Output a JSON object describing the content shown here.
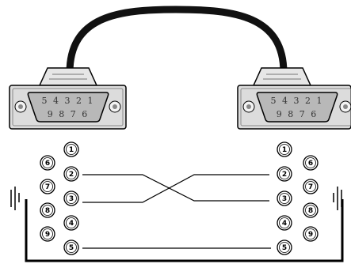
{
  "connectors": [
    {
      "side": "left",
      "face_rows": [
        [
          "5",
          "4",
          "3",
          "2",
          "1"
        ],
        [
          "9",
          "8",
          "7",
          "6"
        ]
      ]
    },
    {
      "side": "right",
      "face_rows": [
        [
          "5",
          "4",
          "3",
          "2",
          "1"
        ],
        [
          "9",
          "8",
          "7",
          "6"
        ]
      ]
    }
  ],
  "pins_left": {
    "column_a": [
      "1",
      "2",
      "3",
      "4",
      "5"
    ],
    "column_b": [
      "6",
      "7",
      "8",
      "9"
    ]
  },
  "pins_right": {
    "column_a": [
      "1",
      "2",
      "3",
      "4",
      "5"
    ],
    "column_b": [
      "6",
      "7",
      "8",
      "9"
    ]
  },
  "wiring": [
    {
      "from": "2",
      "to": "3"
    },
    {
      "from": "3",
      "to": "2"
    },
    {
      "from": "5",
      "to": "5"
    }
  ],
  "colors": {
    "cable": "#111111",
    "connector_fill": "#d9d9d9",
    "line": "#000000"
  }
}
